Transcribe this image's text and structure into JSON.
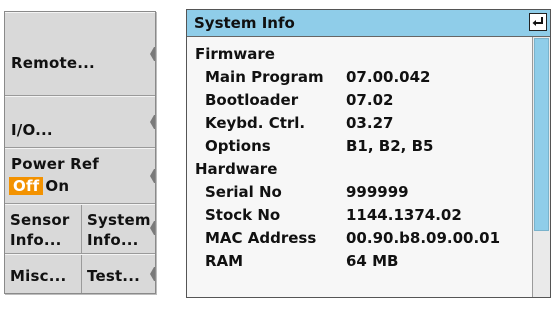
{
  "softkeys": {
    "remote": "Remote...",
    "io": "I/O...",
    "power_ref": {
      "label": "Power Ref",
      "off": "Off",
      "on": "On"
    },
    "sensor": {
      "line1": "Sensor",
      "line2": "Info..."
    },
    "system": {
      "line1": "System",
      "line2": "Info..."
    },
    "misc": "Misc...",
    "test": "Test..."
  },
  "window": {
    "title": "System Info",
    "firmware": {
      "heading": "Firmware",
      "rows": [
        {
          "label": "Main Program",
          "value": "07.00.042"
        },
        {
          "label": "Bootloader",
          "value": "07.02"
        },
        {
          "label": "Keybd. Ctrl.",
          "value": "03.27"
        },
        {
          "label": "Options",
          "value": "B1, B2, B5"
        }
      ]
    },
    "hardware": {
      "heading": "Hardware",
      "rows": [
        {
          "label": "Serial No",
          "value": "999999"
        },
        {
          "label": "Stock No",
          "value": "1144.1374.02"
        },
        {
          "label": "MAC Address",
          "value": "00.90.b8.09.00.01"
        },
        {
          "label": "RAM",
          "value": "64 MB"
        }
      ]
    }
  },
  "colors": {
    "accent": "#8fcde9",
    "selected_option": "#f39200",
    "softkey_bg": "#d9d9d9"
  },
  "icons": [
    "enter-icon",
    "softkey-notch-icon"
  ]
}
